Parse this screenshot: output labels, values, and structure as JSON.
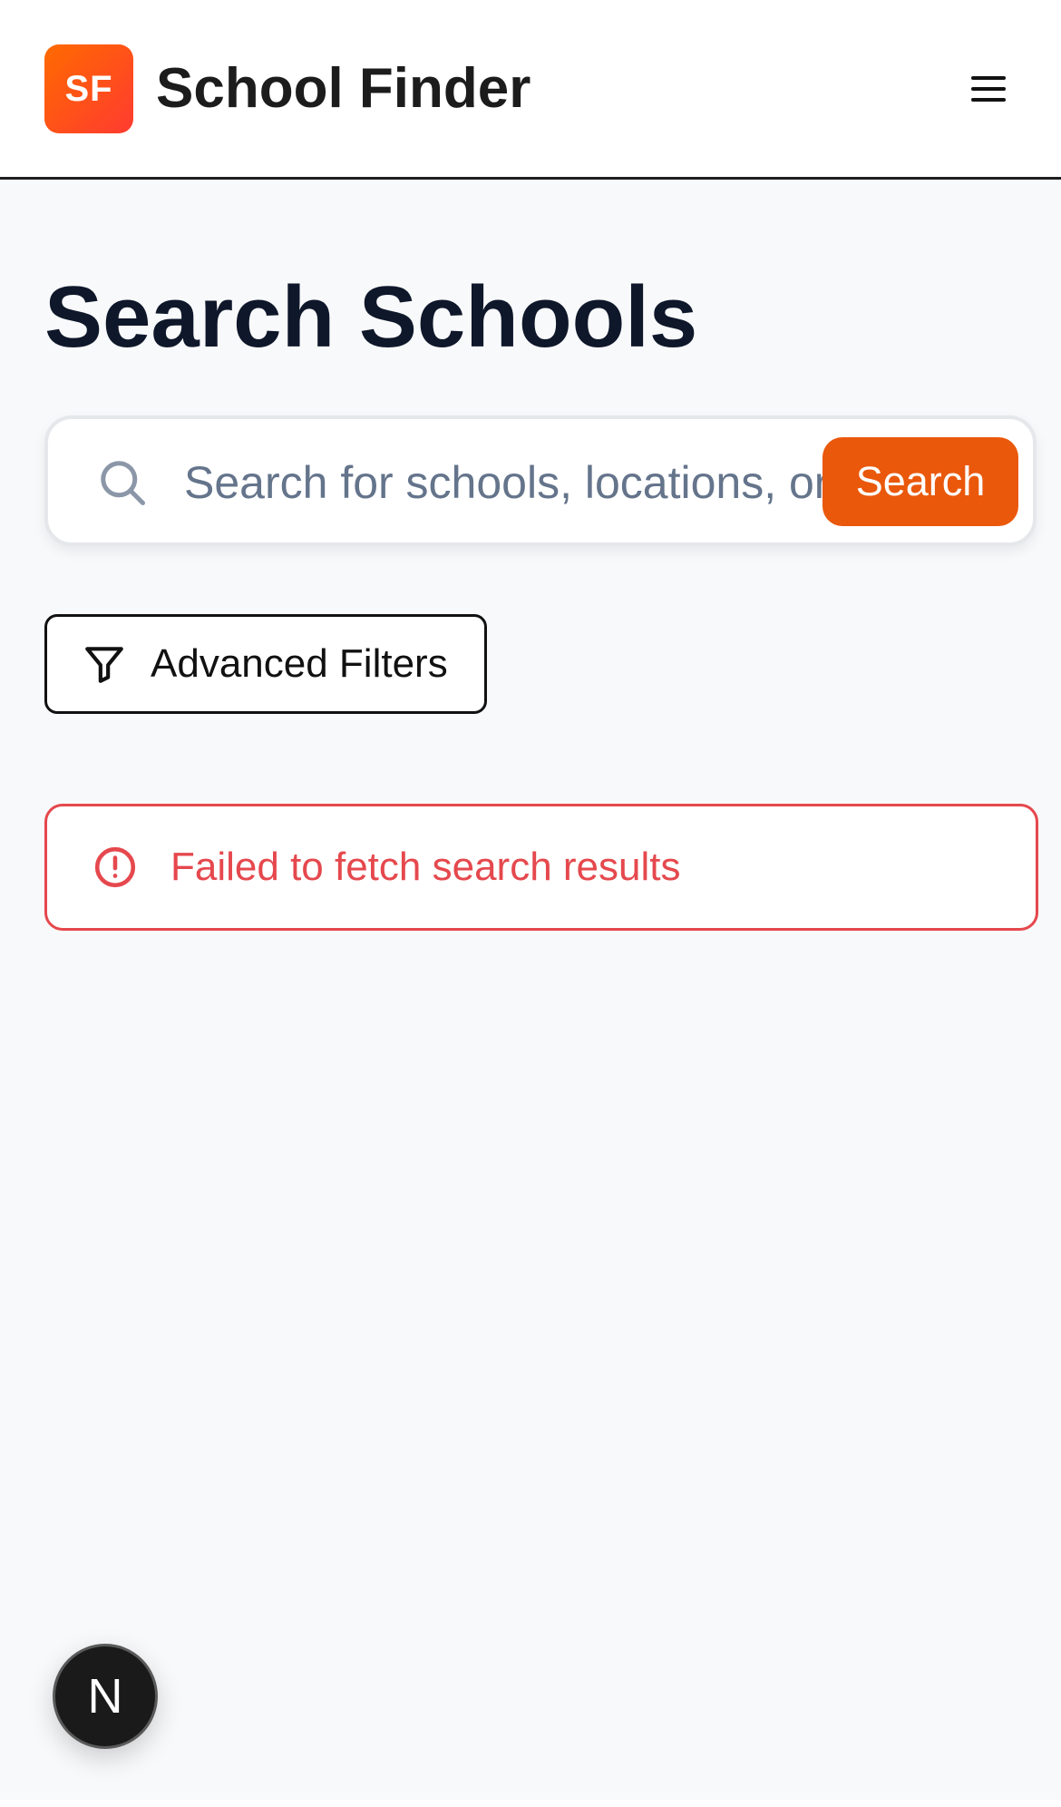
{
  "header": {
    "logo_text": "SF",
    "app_title": "School Finder",
    "menu_icon": "hamburger-menu-icon"
  },
  "main": {
    "page_title": "Search Schools",
    "search": {
      "placeholder": "Search for schools, locations, or programs",
      "value": "",
      "button_label": "Search",
      "icon": "search-icon"
    },
    "filters": {
      "label": "Advanced Filters",
      "icon": "filter-icon"
    },
    "error": {
      "message": "Failed to fetch search results",
      "icon": "alert-circle-icon"
    }
  },
  "dev_badge": {
    "label": "N"
  },
  "colors": {
    "accent": "#ea580c",
    "error": "#e5484d",
    "title": "#0f172a",
    "background": "#f8f9fb"
  }
}
